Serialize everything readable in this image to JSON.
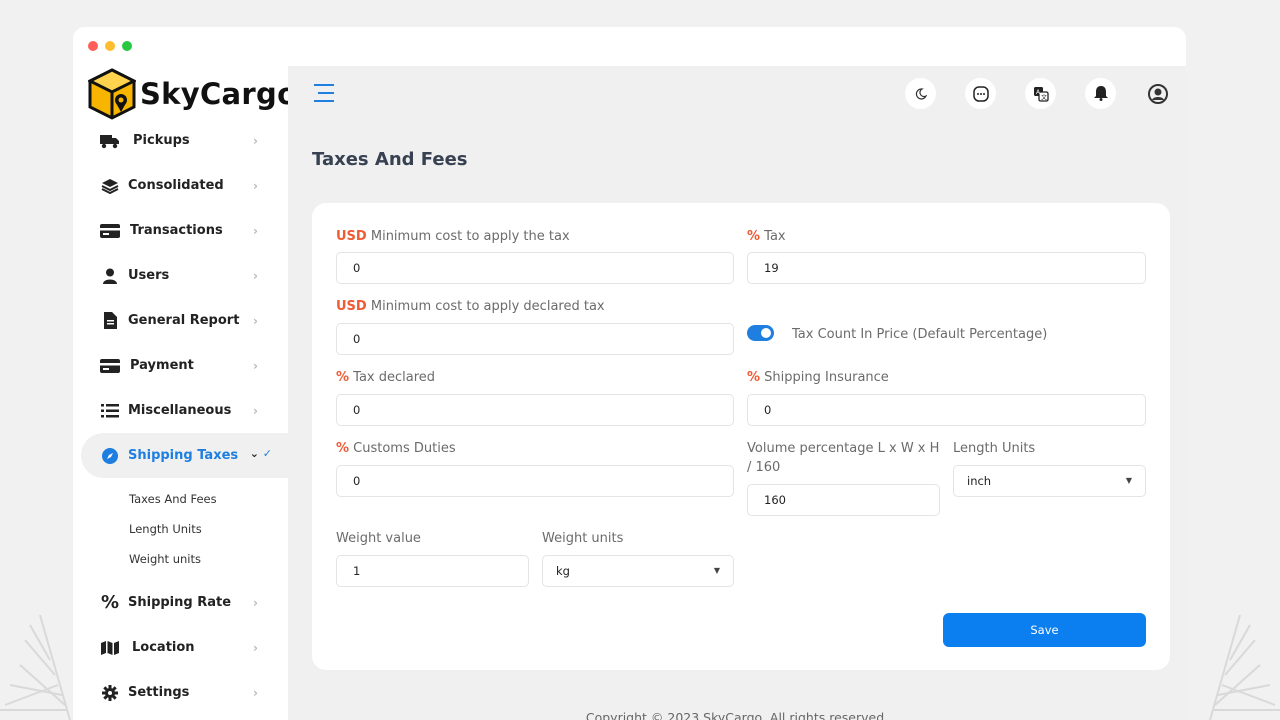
{
  "app": {
    "brand": "SkyCargo",
    "brand_color": "#1e7fe0",
    "accent_orange": "#ef5b34",
    "window_dots": [
      "#ff5f57",
      "#febc2e",
      "#28c840"
    ]
  },
  "sidebar": {
    "items": [
      {
        "label": "Pickups",
        "icon": "truck-icon"
      },
      {
        "label": "Consolidated",
        "icon": "layers-icon"
      },
      {
        "label": "Transactions",
        "icon": "card-icon"
      },
      {
        "label": "Users",
        "icon": "user-icon"
      },
      {
        "label": "General Report",
        "icon": "document-icon"
      },
      {
        "label": "Payment",
        "icon": "card-icon"
      },
      {
        "label": "Miscellaneous",
        "icon": "list-icon"
      },
      {
        "label": "Shipping Taxes",
        "icon": "compass-icon",
        "active": true
      },
      {
        "label": "Shipping Rate",
        "icon": "percent-icon"
      },
      {
        "label": "Location",
        "icon": "map-icon"
      },
      {
        "label": "Settings",
        "icon": "gear-icon"
      }
    ],
    "subitems": [
      "Taxes And Fees",
      "Length Units",
      "Weight units"
    ]
  },
  "header": {
    "icons": [
      "moon-icon",
      "chat-icon",
      "translate-icon",
      "bell-icon",
      "user-circle-icon"
    ]
  },
  "page": {
    "title": "Taxes And Fees"
  },
  "form": {
    "min_cost_tax": {
      "prefix": "USD",
      "label": "Minimum cost to apply the tax",
      "value": "0"
    },
    "tax": {
      "prefix": "%",
      "label": "Tax",
      "value": "19"
    },
    "min_cost_declared": {
      "prefix": "USD",
      "label": "Minimum cost to apply declared tax",
      "value": "0"
    },
    "tax_count_toggle": {
      "label": "Tax Count In Price (Default Percentage)",
      "on": true
    },
    "tax_declared": {
      "prefix": "%",
      "label": "Tax declared",
      "value": "0"
    },
    "shipping_insurance": {
      "prefix": "%",
      "label": "Shipping Insurance",
      "value": "0"
    },
    "customs_duties": {
      "prefix": "%",
      "label": "Customs Duties",
      "value": "0"
    },
    "volume_percentage": {
      "label": "Volume percentage L x W x H / 160",
      "value": "160"
    },
    "length_units": {
      "label": "Length Units",
      "value": "inch"
    },
    "weight_value": {
      "label": "Weight value",
      "value": "1"
    },
    "weight_units": {
      "label": "Weight units",
      "value": "kg"
    },
    "save_label": "Save"
  },
  "footer": {
    "text": "Copyright © 2023 SkyCargo. All rights reserved."
  }
}
